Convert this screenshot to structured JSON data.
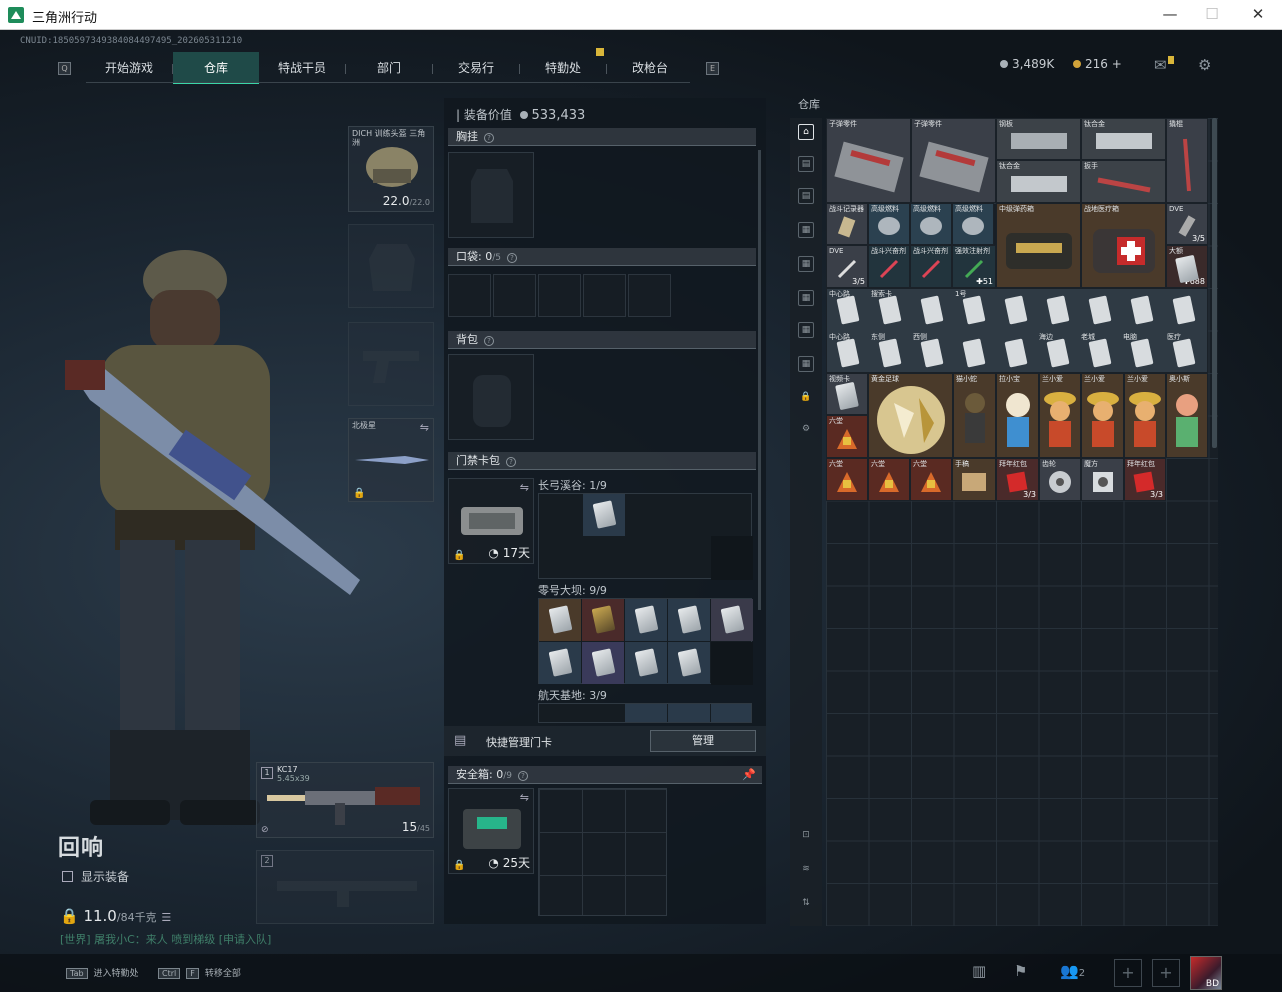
{
  "window": {
    "title": "三角洲行动",
    "minimize": "—",
    "maximize": "☐",
    "close": "✕"
  },
  "cnuid": "CNUID:1850597349384084497495_202605311210",
  "nav": {
    "tabs": [
      {
        "label": "开始游戏"
      },
      {
        "label": "仓库",
        "active": true
      },
      {
        "label": "特战干员"
      },
      {
        "label": "部门"
      },
      {
        "label": "交易行"
      },
      {
        "label": "特勤处"
      },
      {
        "label": "改枪台"
      }
    ],
    "left_key": "Q",
    "right_key": "E"
  },
  "currency": {
    "silver": "3,489K",
    "gold": "216",
    "gold_add": "+"
  },
  "character": {
    "name": "回响",
    "show_equipment": "显示装备",
    "weight": "11.0",
    "weight_unit": "/84千克",
    "chat": "[世界] 屠我小C：来人 喷到梯级 [申请入队]"
  },
  "gear": {
    "helmet": {
      "label": "DICH 训练头盔 三角洲",
      "durability": "22.0",
      "durability_max": "/22.0"
    },
    "knife": {
      "label": "北极星"
    },
    "weapon1": {
      "slot": "1",
      "name": "KC17",
      "ammo_type": "5.45x39",
      "ammo": "15",
      "ammo_max": "/45"
    },
    "weapon2": {
      "slot": "2"
    }
  },
  "equipment": {
    "value_label": "装备价值",
    "value": "533,433",
    "chest_label": "胸挂",
    "pocket_label": "口袋:",
    "pocket_count": "0",
    "pocket_max": "/5",
    "backpack_label": "背包",
    "keycard_label": "门禁卡包",
    "keycard_days": "17天",
    "maps": [
      {
        "name": "长弓溪谷: 1/9"
      },
      {
        "name": "零号大坝: 9/9"
      },
      {
        "name": "航天基地: 3/9"
      }
    ],
    "quick_manage": "快捷管理门卡",
    "manage_btn": "管理",
    "safe_label": "安全箱:",
    "safe_count": "0",
    "safe_max": "/9",
    "safe_days": "25天"
  },
  "warehouse": {
    "label": "仓库",
    "items": [
      {
        "name": "子弹零件",
        "type": "ammo-box"
      },
      {
        "name": "子弹零件",
        "type": "ammo-box"
      },
      {
        "name": "钢板",
        "type": "metal-plate"
      },
      {
        "name": "钛合金",
        "type": "metal-plate"
      },
      {
        "name": "钛合金",
        "type": "metal-plate"
      },
      {
        "name": "扳手",
        "type": "tool"
      },
      {
        "name": "撬棍",
        "type": "tool"
      },
      {
        "name": "战斗记录器",
        "type": "device"
      },
      {
        "name": "高级燃料",
        "type": "can"
      },
      {
        "name": "高级燃料",
        "type": "can"
      },
      {
        "name": "高级燃料",
        "type": "can"
      },
      {
        "name": "中级弹药箱",
        "type": "case"
      },
      {
        "name": "战地医疗箱",
        "type": "medkit"
      },
      {
        "name": "DVE",
        "count": "3/5",
        "type": "device"
      },
      {
        "name": "DVE",
        "count": "3/5",
        "type": "syringe"
      },
      {
        "name": "战斗兴奋剂",
        "type": "syringe"
      },
      {
        "name": "战斗兴奋剂",
        "type": "syringe"
      },
      {
        "name": "强效注射剂",
        "count": "51",
        "type": "syringe"
      },
      {
        "name": "大额",
        "count": "688",
        "type": "cash"
      },
      {
        "name": "中心路",
        "type": "card"
      },
      {
        "name": "搜索卡",
        "type": "card"
      },
      {
        "name": "1号",
        "type": "card"
      },
      {
        "name": "西侧",
        "type": "card"
      },
      {
        "name": "东侧",
        "type": "card"
      },
      {
        "name": "海边",
        "type": "card"
      },
      {
        "name": "老城",
        "type": "card"
      },
      {
        "name": "电脑",
        "type": "card"
      },
      {
        "name": "医疗",
        "type": "card"
      },
      {
        "name": "视频卡",
        "type": "card"
      },
      {
        "name": "黄金足球",
        "type": "gold-ball"
      },
      {
        "name": "猫小蛇",
        "type": "figure"
      },
      {
        "name": "拉小宝",
        "type": "figure"
      },
      {
        "name": "兰小爱",
        "type": "figure"
      },
      {
        "name": "兰小爱",
        "type": "figure"
      },
      {
        "name": "兰小爱",
        "type": "figure"
      },
      {
        "name": "奥小斯",
        "type": "figure"
      },
      {
        "name": "六堂",
        "type": "pouch"
      },
      {
        "name": "六堂",
        "type": "pouch"
      },
      {
        "name": "六堂",
        "type": "pouch"
      },
      {
        "name": "六堂",
        "type": "pouch"
      },
      {
        "name": "手稿",
        "type": "paper"
      },
      {
        "name": "拜年红包",
        "count": "3/3",
        "type": "redpack"
      },
      {
        "name": "齿轮",
        "type": "gear"
      },
      {
        "name": "魔方",
        "type": "cube"
      },
      {
        "name": "拜年红包",
        "count": "3/3",
        "type": "redpack"
      }
    ]
  },
  "bottom": {
    "tab_key": "Tab",
    "tab_action": "进入特勤处",
    "ctrl_key": "Ctrl",
    "f_key": "F",
    "ctrl_action": "转移全部",
    "friends": "2",
    "avatar_tag": "BD"
  }
}
